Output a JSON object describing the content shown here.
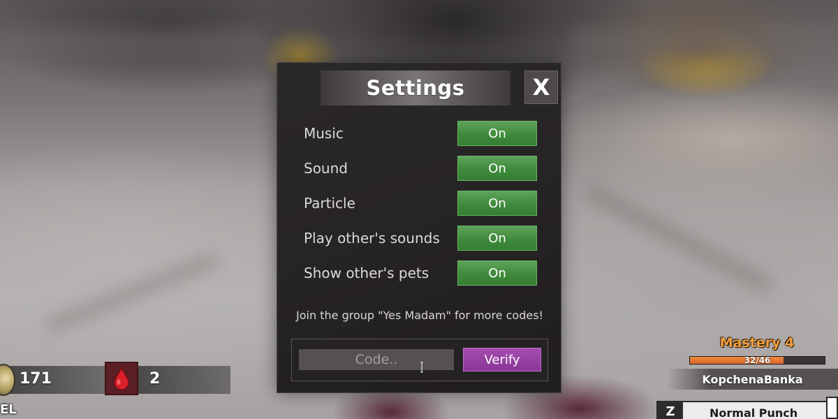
{
  "settings_panel": {
    "title": "Settings",
    "close_label": "X",
    "rows": [
      {
        "label": "Music",
        "state": "On"
      },
      {
        "label": "Sound",
        "state": "On"
      },
      {
        "label": "Particle",
        "state": "On"
      },
      {
        "label": "Play other's sounds",
        "state": "On"
      },
      {
        "label": "Show other's pets",
        "state": "On"
      }
    ],
    "promo_text": "Join the group \"Yes Madam\" for more codes!",
    "code_input": {
      "placeholder": "Code..",
      "value": ""
    },
    "verify_label": "Verify"
  },
  "hud": {
    "coins": "171",
    "blood": "2",
    "level_partial": "EL",
    "mastery": "Mastery 4",
    "xp_text": "32/46",
    "xp_fraction": 0.6957,
    "username": "KopchenaBanka",
    "skill_key": "Z",
    "skill_name": "Normal Punch"
  },
  "colors": {
    "toggle_on": "#3f8a3c",
    "verify": "#8a3597",
    "mastery": "#f0a040",
    "xp_fill": "#e0702f"
  },
  "icons": {
    "close": "close-icon",
    "coin": "coin-icon",
    "blood": "blood-drop-icon",
    "cursor": "text-cursor-icon"
  }
}
